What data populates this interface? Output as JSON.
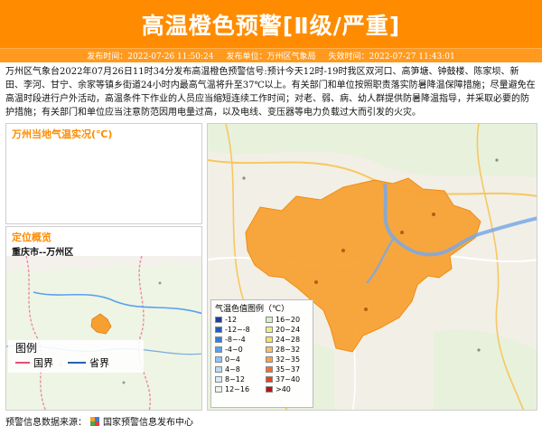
{
  "header": {
    "title": "高温橙色预警[Ⅱ级/严重]"
  },
  "subbar": {
    "publish_time_label": "发布时间：",
    "publish_time": "2022-07-26 11:50:24",
    "unit_label": "发布单位：",
    "unit": "万州区气象局",
    "expire_label": "失效时间：",
    "expire_time": "2022-07-27 11:43:01"
  },
  "content": {
    "text": "万州区气象台2022年07月26日11时34分发布高温橙色预警信号:预计今天12时-19时我区双河口、高笋塘、钟鼓楼、陈家坝、新田、李河、甘宁、余家等镇乡街道24小时内最高气温将升至37℃以上。有关部门和单位按照职责落实防暑降温保障措施；尽量避免在高温时段进行户外活动，高温条件下作业的人员应当缩短连续工作时间；对老、弱、病、幼人群提供防暑降温指导，并采取必要的防护措施；有关部门和单位应当注意防范因用电量过高，以及电线、变压器等电力负载过大而引发的火灾。"
  },
  "panels": {
    "realtime_title": "万州当地气温实况(℃)",
    "location_title": "定位概览",
    "location_sub": "重庆市--万州区"
  },
  "mini_legend": {
    "title": "图例",
    "guojie": "国界",
    "shengjie": "省界"
  },
  "legend": {
    "title": "气温色值图例（℃）",
    "items": [
      {
        "label": "-12",
        "color": "#1f3d99"
      },
      {
        "label": "16~20",
        "color": "#d8f0c8"
      },
      {
        "label": "-12~-8",
        "color": "#1e5fc0"
      },
      {
        "label": "20~24",
        "color": "#e8f08a"
      },
      {
        "label": "-8~-4",
        "color": "#2f7fe0"
      },
      {
        "label": "24~28",
        "color": "#f8e060"
      },
      {
        "label": "-4~0",
        "color": "#5aa0f0"
      },
      {
        "label": "28~32",
        "color": "#f8c070"
      },
      {
        "label": "0~4",
        "color": "#8fc4f5"
      },
      {
        "label": "32~35",
        "color": "#f8a050"
      },
      {
        "label": "4~8",
        "color": "#b9dcf8"
      },
      {
        "label": "35~37",
        "color": "#f07030"
      },
      {
        "label": "8~12",
        "color": "#d6ecf9"
      },
      {
        "label": "37~40",
        "color": "#e84020"
      },
      {
        "label": "12~16",
        "color": "#e9f6ee"
      },
      {
        "label": ">40",
        "color": "#c01010"
      }
    ]
  },
  "footer": {
    "label": "预警信息数据来源：",
    "source": "国家预警信息发布中心"
  },
  "colors": {
    "accent": "#ff8c00",
    "area": "#f7a030"
  }
}
